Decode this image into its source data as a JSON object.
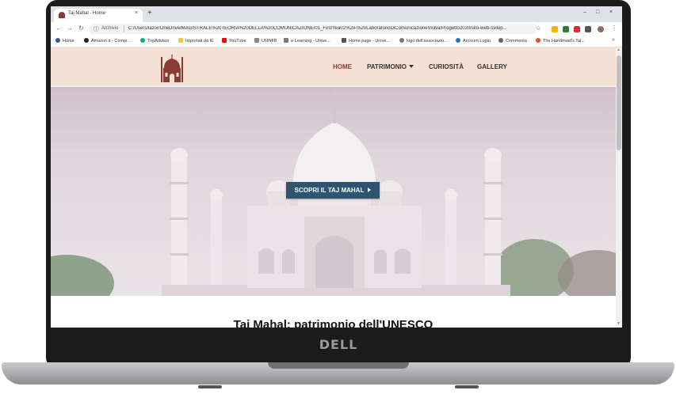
{
  "browser": {
    "tab_title": "Taj Mahal - Home",
    "new_tab": "+",
    "close_tab": "×",
    "omnibox_label": "Archivio",
    "url": "C:/Users/lazor/OneDrive/MAGISTRALE%20TEORIA%20DELLA%20COMUNICAZIONE/01_FirstYear/2%20-%20LaboratorioDiComunicazioneVisiva/Progetto2020/sito-web-svilup..."
  },
  "bookmarks": [
    {
      "label": "Home",
      "color": "#3b5998"
    },
    {
      "label": "Amazon.it - Compr...",
      "color": "#222222"
    },
    {
      "label": "TripAdvisor",
      "color": "#00af87"
    },
    {
      "label": "Importati da IE",
      "color": "#f4c542"
    },
    {
      "label": "YouTube",
      "color": "#ff0000"
    },
    {
      "label": "UNIMIB",
      "color": "#888888"
    },
    {
      "label": "e-Learning - Unive...",
      "color": "#7a7a7a"
    },
    {
      "label": "Home page - Unive...",
      "color": "#555555"
    },
    {
      "label": "logo dell'associazio...",
      "color": "#777777"
    },
    {
      "label": "Account Login",
      "color": "#2a6fbf"
    },
    {
      "label": "Commenta",
      "color": "#666666"
    },
    {
      "label": "The Handmaid's Tal...",
      "color": "#e44d26"
    }
  ],
  "site": {
    "nav": {
      "home": "HOME",
      "patrimonio": "PATRIMONIO",
      "curiosita": "CURIOSITÀ",
      "gallery": "GALLERY"
    },
    "hero_button": "SCOPRI IL TAJ MAHAL",
    "page_title": "Taj Mahal: patrimonio dell'UNESCO",
    "accent_color": "#8c3a34",
    "header_bg": "#f5e0d6",
    "button_color": "#2e5470"
  },
  "device": {
    "brand": "DELL"
  }
}
